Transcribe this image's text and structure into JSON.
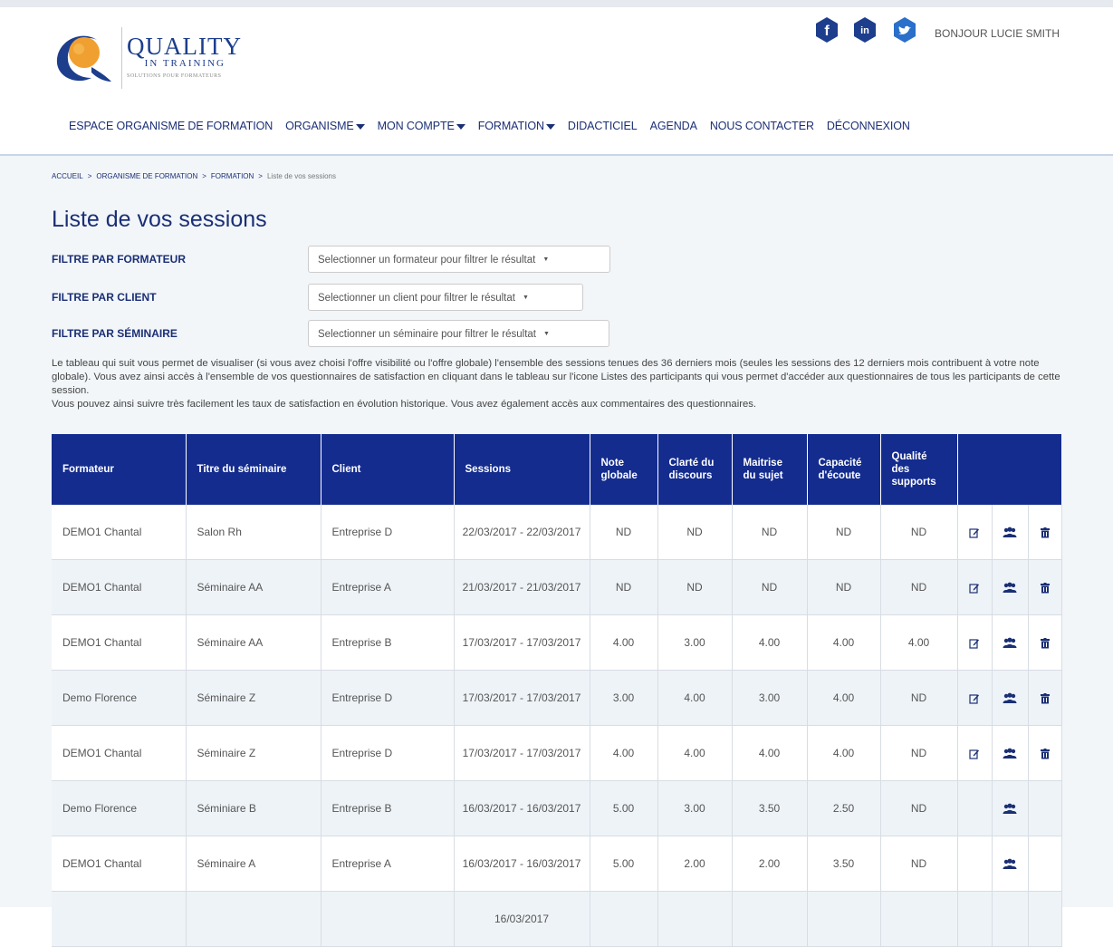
{
  "header": {
    "brand_name": "QUALITY",
    "brand_sub": "IN TRAINING",
    "brand_tagline": "SOLUTIONS POUR FORMATEURS",
    "greeting": "BONJOUR LUCIE SMITH",
    "social": [
      "facebook-icon",
      "linkedin-icon",
      "twitter-icon"
    ],
    "colors": {
      "brand_blue": "#1b2f75",
      "logo_orange": "#f0a030",
      "table_header": "#142c8e"
    }
  },
  "nav": {
    "items": [
      {
        "label": "ESPACE ORGANISME DE FORMATION",
        "dropdown": false
      },
      {
        "label": "ORGANISME",
        "dropdown": true
      },
      {
        "label": "MON COMPTE",
        "dropdown": true
      },
      {
        "label": "FORMATION",
        "dropdown": true
      },
      {
        "label": "DIDACTICIEL",
        "dropdown": false
      },
      {
        "label": "AGENDA",
        "dropdown": false
      },
      {
        "label": "NOUS CONTACTER",
        "dropdown": false
      },
      {
        "label": "DÉCONNEXION",
        "dropdown": false
      }
    ]
  },
  "breadcrumb": [
    "ACCUEIL",
    "ORGANISME DE FORMATION",
    "FORMATION",
    "Liste de vos sessions"
  ],
  "page": {
    "title": "Liste de vos sessions"
  },
  "filters": [
    {
      "label": "FILTRE PAR FORMATEUR",
      "placeholder": "Selectionner un formateur pour filtrer le résultat"
    },
    {
      "label": "FILTRE PAR CLIENT",
      "placeholder": "Selectionner un client pour filtrer le résultat"
    },
    {
      "label": "FILTRE PAR SÉMINAIRE",
      "placeholder": "Selectionner un séminaire pour filtrer le résultat"
    }
  ],
  "intro": [
    "Le tableau qui suit vous permet de visualiser (si vous avez choisi l'offre visibilité ou l'offre globale) l'ensemble des sessions tenues des 36 derniers mois (seules les sessions des 12 derniers mois contribuent à votre note globale). Vous avez ainsi accès à l'ensemble de vos questionnaires de satisfaction en cliquant dans le tableau sur l'icone Listes des participants qui vous permet d'accéder aux questionnaires de tous les participants de cette session.",
    "Vous pouvez ainsi suivre très facilement les taux de satisfaction en évolution historique. Vous avez également accès aux commentaires des questionnaires."
  ],
  "table": {
    "headers": [
      "Formateur",
      "Titre du séminaire",
      "Client",
      "Sessions",
      "Note globale",
      "Clarté du discours",
      "Maitrise du sujet",
      "Capacité d'écoute",
      "Qualité des supports"
    ],
    "rows": [
      {
        "formateur": "DEMO1 Chantal",
        "titre": "Salon Rh",
        "client": "Entreprise D",
        "session": "22/03/2017 - 22/03/2017",
        "note": "ND",
        "clarte": "ND",
        "maitrise": "ND",
        "ecoute": "ND",
        "supports": "ND",
        "edit": true,
        "participants": true,
        "delete": true
      },
      {
        "formateur": "DEMO1 Chantal",
        "titre": "Séminaire AA",
        "client": "Entreprise A",
        "session": "21/03/2017 - 21/03/2017",
        "note": "ND",
        "clarte": "ND",
        "maitrise": "ND",
        "ecoute": "ND",
        "supports": "ND",
        "edit": true,
        "participants": true,
        "delete": true
      },
      {
        "formateur": "DEMO1 Chantal",
        "titre": "Séminaire AA",
        "client": "Entreprise B",
        "session": "17/03/2017 - 17/03/2017",
        "note": "4.00",
        "clarte": "3.00",
        "maitrise": "4.00",
        "ecoute": "4.00",
        "supports": "4.00",
        "edit": true,
        "participants": true,
        "delete": true
      },
      {
        "formateur": "Demo Florence",
        "titre": "Séminaire Z",
        "client": "Entreprise D",
        "session": "17/03/2017 - 17/03/2017",
        "note": "3.00",
        "clarte": "4.00",
        "maitrise": "3.00",
        "ecoute": "4.00",
        "supports": "ND",
        "edit": true,
        "participants": true,
        "delete": true
      },
      {
        "formateur": "DEMO1 Chantal",
        "titre": "Séminaire Z",
        "client": "Entreprise D",
        "session": "17/03/2017 - 17/03/2017",
        "note": "4.00",
        "clarte": "4.00",
        "maitrise": "4.00",
        "ecoute": "4.00",
        "supports": "ND",
        "edit": true,
        "participants": true,
        "delete": true
      },
      {
        "formateur": "Demo Florence",
        "titre": "Séminiare B",
        "client": "Entreprise B",
        "session": "16/03/2017 - 16/03/2017",
        "note": "5.00",
        "clarte": "3.00",
        "maitrise": "3.50",
        "ecoute": "2.50",
        "supports": "ND",
        "edit": false,
        "participants": true,
        "delete": false
      },
      {
        "formateur": "DEMO1 Chantal",
        "titre": "Séminaire A",
        "client": "Entreprise A",
        "session": "16/03/2017 - 16/03/2017",
        "note": "5.00",
        "clarte": "2.00",
        "maitrise": "2.00",
        "ecoute": "3.50",
        "supports": "ND",
        "edit": false,
        "participants": true,
        "delete": false
      },
      {
        "formateur": "",
        "titre": "",
        "client": "",
        "session": "16/03/2017",
        "note": "",
        "clarte": "",
        "maitrise": "",
        "ecoute": "",
        "supports": "",
        "edit": false,
        "participants": false,
        "delete": false
      }
    ]
  }
}
